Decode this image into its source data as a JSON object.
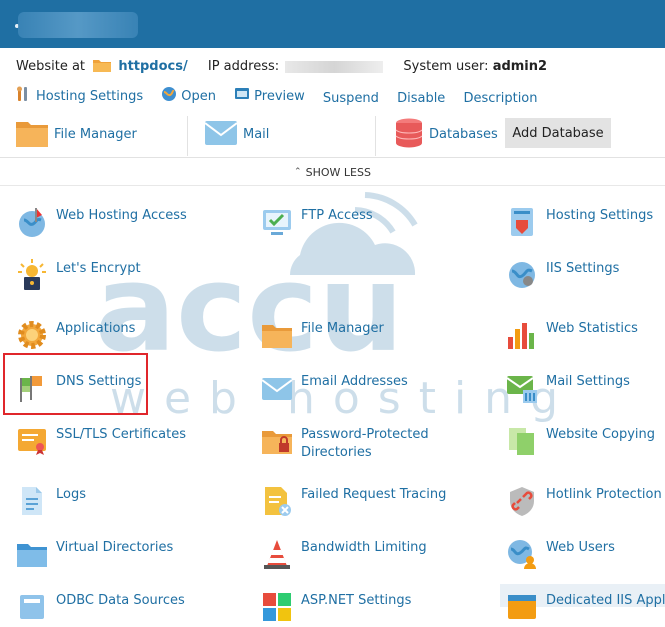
{
  "header": {
    "title_blurred": true
  },
  "info": {
    "website_at_label": "Website at",
    "domain_link": "httpdocs/",
    "ip_label": "IP address:",
    "system_user_label": "System user:",
    "system_user": "admin2"
  },
  "actions": [
    {
      "label": "Hosting Settings",
      "icon": "wrench-icon"
    },
    {
      "label": "Open",
      "icon": "globe-icon"
    },
    {
      "label": "Preview",
      "icon": "preview-icon"
    },
    {
      "label": "Suspend"
    },
    {
      "label": "Disable"
    },
    {
      "label": "Description"
    }
  ],
  "quickbar": {
    "file_manager": "File Manager",
    "mail": "Mail",
    "databases": "Databases",
    "add_database": "Add Database"
  },
  "show_less": "SHOW LESS",
  "tools": [
    {
      "label": "Web Hosting Access",
      "icon": "web-hosting-access-icon"
    },
    {
      "label": "FTP Access",
      "icon": "ftp-access-icon"
    },
    {
      "label": "Hosting Settings",
      "icon": "hosting-settings-icon"
    },
    {
      "label": "Let's Encrypt",
      "icon": "lets-encrypt-icon"
    },
    {
      "label": "IIS Settings",
      "icon": "iis-settings-icon"
    },
    {
      "label": "Applications",
      "icon": "applications-gear-icon"
    },
    {
      "label": "File Manager",
      "icon": "folder-icon"
    },
    {
      "label": "Web Statistics",
      "icon": "bar-chart-icon"
    },
    {
      "label": "DNS Settings",
      "icon": "dns-flags-icon"
    },
    {
      "label": "Email Addresses",
      "icon": "envelope-icon"
    },
    {
      "label": "Mail Settings",
      "icon": "mail-settings-icon"
    },
    {
      "label": "SSL/TLS Certificates",
      "icon": "certificate-icon"
    },
    {
      "label": "Password-Protected Directories",
      "icon": "protected-folder-icon"
    },
    {
      "label": "Website Copying",
      "icon": "copy-icon"
    },
    {
      "label": "Logs",
      "icon": "log-file-icon"
    },
    {
      "label": "Failed Request Tracing",
      "icon": "failed-request-icon"
    },
    {
      "label": "Hotlink Protection",
      "icon": "hotlink-protection-icon"
    },
    {
      "label": "Virtual Directories",
      "icon": "virtual-directory-icon"
    },
    {
      "label": "Bandwidth Limiting",
      "icon": "bandwidth-cone-icon"
    },
    {
      "label": "Web Users",
      "icon": "web-users-icon"
    },
    {
      "label": "ODBC Data Sources",
      "icon": "odbc-icon"
    },
    {
      "label": "ASP.NET Settings",
      "icon": "aspnet-icon"
    },
    {
      "label": "Dedicated IIS Applic",
      "icon": "dedicated-iis-icon"
    }
  ],
  "watermark": {
    "line1": "accu",
    "line2": "web hosting"
  },
  "colors": {
    "topbar": "#1f6fa3",
    "link": "#1f6fa3",
    "highlight": "#e0262b"
  }
}
